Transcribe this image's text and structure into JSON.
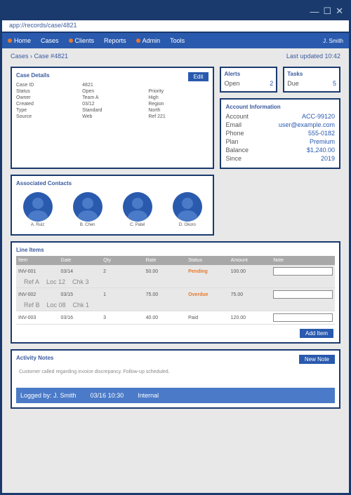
{
  "window": {
    "min": "—",
    "max": "☐",
    "close": "✕"
  },
  "url": "app://records/case/4821",
  "nav": {
    "items": [
      "Home",
      "Cases",
      "Clients",
      "Reports",
      "Admin",
      "Tools"
    ],
    "user": "J. Smith"
  },
  "crumb": {
    "path": "Cases › Case #4821",
    "meta": "Last updated 10:42"
  },
  "details": {
    "title": "Case Details",
    "action": "Edit",
    "fields": [
      [
        "Case ID",
        "4821",
        ""
      ],
      [
        "Status",
        "Open",
        "Priority"
      ],
      [
        "Owner",
        "Team A",
        "High"
      ],
      [
        "Created",
        "03/12",
        "Region"
      ],
      [
        "Type",
        "Standard",
        "North"
      ],
      [
        "Source",
        "Web",
        "Ref 221"
      ]
    ]
  },
  "mini": [
    {
      "title": "Alerts",
      "lines": [
        [
          "Open",
          "2"
        ]
      ]
    },
    {
      "title": "Tasks",
      "lines": [
        [
          "Due",
          "5"
        ]
      ]
    }
  ],
  "info": {
    "title": "Account Information",
    "lines": [
      [
        "Account",
        "ACC-99120"
      ],
      [
        "Email",
        "user@example.com"
      ],
      [
        "Phone",
        "555-0182"
      ],
      [
        "Plan",
        "Premium"
      ],
      [
        "Balance",
        "$1,240.00"
      ],
      [
        "Since",
        "2019"
      ]
    ]
  },
  "contacts": {
    "title": "Associated Contacts",
    "people": [
      {
        "name": "A. Ruiz"
      },
      {
        "name": "B. Chen"
      },
      {
        "name": "C. Patel"
      },
      {
        "name": "D. Okoro"
      }
    ]
  },
  "table": {
    "title": "Line Items",
    "headers": [
      "Item",
      "Date",
      "Qty",
      "Rate",
      "Status",
      "Amount",
      "Note"
    ],
    "rows": [
      {
        "cells": [
          "INV-001",
          "03/14",
          "2",
          "50.00",
          "Pending",
          "100.00"
        ],
        "hl": 4,
        "note": "",
        "sub": [
          "Ref A",
          "Loc 12",
          "Chk 3"
        ]
      },
      {
        "cells": [
          "INV-002",
          "03/15",
          "1",
          "75.00",
          "Overdue",
          "75.00"
        ],
        "hl": 4,
        "note": "",
        "sub": [
          "Ref B",
          "Loc 08",
          "Chk 1"
        ]
      },
      {
        "cells": [
          "INV-003",
          "03/16",
          "3",
          "40.00",
          "Paid",
          "120.00"
        ],
        "hl": -1,
        "note": "",
        "sub": []
      }
    ],
    "action": "Add Item"
  },
  "notes": {
    "title": "Activity Notes",
    "action": "New Note",
    "body": "Customer called regarding invoice discrepancy. Follow-up scheduled.",
    "footer": [
      "Logged by: J. Smith",
      "03/16 10:30",
      "Internal"
    ]
  }
}
